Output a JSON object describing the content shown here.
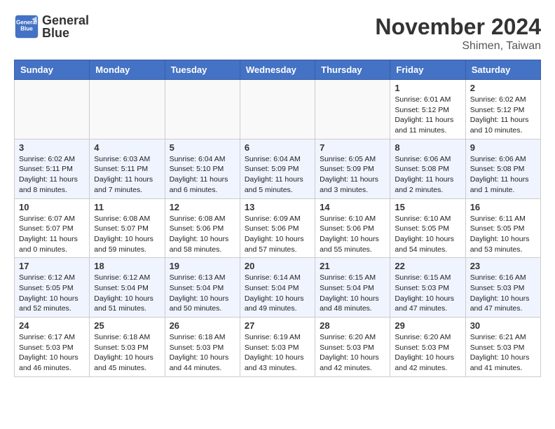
{
  "logo": {
    "line1": "General",
    "line2": "Blue"
  },
  "title": "November 2024",
  "subtitle": "Shimen, Taiwan",
  "days_of_week": [
    "Sunday",
    "Monday",
    "Tuesday",
    "Wednesday",
    "Thursday",
    "Friday",
    "Saturday"
  ],
  "weeks": [
    [
      {
        "day": "",
        "info": ""
      },
      {
        "day": "",
        "info": ""
      },
      {
        "day": "",
        "info": ""
      },
      {
        "day": "",
        "info": ""
      },
      {
        "day": "",
        "info": ""
      },
      {
        "day": "1",
        "info": "Sunrise: 6:01 AM\nSunset: 5:12 PM\nDaylight: 11 hours\nand 11 minutes."
      },
      {
        "day": "2",
        "info": "Sunrise: 6:02 AM\nSunset: 5:12 PM\nDaylight: 11 hours\nand 10 minutes."
      }
    ],
    [
      {
        "day": "3",
        "info": "Sunrise: 6:02 AM\nSunset: 5:11 PM\nDaylight: 11 hours\nand 8 minutes."
      },
      {
        "day": "4",
        "info": "Sunrise: 6:03 AM\nSunset: 5:11 PM\nDaylight: 11 hours\nand 7 minutes."
      },
      {
        "day": "5",
        "info": "Sunrise: 6:04 AM\nSunset: 5:10 PM\nDaylight: 11 hours\nand 6 minutes."
      },
      {
        "day": "6",
        "info": "Sunrise: 6:04 AM\nSunset: 5:09 PM\nDaylight: 11 hours\nand 5 minutes."
      },
      {
        "day": "7",
        "info": "Sunrise: 6:05 AM\nSunset: 5:09 PM\nDaylight: 11 hours\nand 3 minutes."
      },
      {
        "day": "8",
        "info": "Sunrise: 6:06 AM\nSunset: 5:08 PM\nDaylight: 11 hours\nand 2 minutes."
      },
      {
        "day": "9",
        "info": "Sunrise: 6:06 AM\nSunset: 5:08 PM\nDaylight: 11 hours\nand 1 minute."
      }
    ],
    [
      {
        "day": "10",
        "info": "Sunrise: 6:07 AM\nSunset: 5:07 PM\nDaylight: 11 hours\nand 0 minutes."
      },
      {
        "day": "11",
        "info": "Sunrise: 6:08 AM\nSunset: 5:07 PM\nDaylight: 10 hours\nand 59 minutes."
      },
      {
        "day": "12",
        "info": "Sunrise: 6:08 AM\nSunset: 5:06 PM\nDaylight: 10 hours\nand 58 minutes."
      },
      {
        "day": "13",
        "info": "Sunrise: 6:09 AM\nSunset: 5:06 PM\nDaylight: 10 hours\nand 57 minutes."
      },
      {
        "day": "14",
        "info": "Sunrise: 6:10 AM\nSunset: 5:06 PM\nDaylight: 10 hours\nand 55 minutes."
      },
      {
        "day": "15",
        "info": "Sunrise: 6:10 AM\nSunset: 5:05 PM\nDaylight: 10 hours\nand 54 minutes."
      },
      {
        "day": "16",
        "info": "Sunrise: 6:11 AM\nSunset: 5:05 PM\nDaylight: 10 hours\nand 53 minutes."
      }
    ],
    [
      {
        "day": "17",
        "info": "Sunrise: 6:12 AM\nSunset: 5:05 PM\nDaylight: 10 hours\nand 52 minutes."
      },
      {
        "day": "18",
        "info": "Sunrise: 6:12 AM\nSunset: 5:04 PM\nDaylight: 10 hours\nand 51 minutes."
      },
      {
        "day": "19",
        "info": "Sunrise: 6:13 AM\nSunset: 5:04 PM\nDaylight: 10 hours\nand 50 minutes."
      },
      {
        "day": "20",
        "info": "Sunrise: 6:14 AM\nSunset: 5:04 PM\nDaylight: 10 hours\nand 49 minutes."
      },
      {
        "day": "21",
        "info": "Sunrise: 6:15 AM\nSunset: 5:04 PM\nDaylight: 10 hours\nand 48 minutes."
      },
      {
        "day": "22",
        "info": "Sunrise: 6:15 AM\nSunset: 5:03 PM\nDaylight: 10 hours\nand 47 minutes."
      },
      {
        "day": "23",
        "info": "Sunrise: 6:16 AM\nSunset: 5:03 PM\nDaylight: 10 hours\nand 47 minutes."
      }
    ],
    [
      {
        "day": "24",
        "info": "Sunrise: 6:17 AM\nSunset: 5:03 PM\nDaylight: 10 hours\nand 46 minutes."
      },
      {
        "day": "25",
        "info": "Sunrise: 6:18 AM\nSunset: 5:03 PM\nDaylight: 10 hours\nand 45 minutes."
      },
      {
        "day": "26",
        "info": "Sunrise: 6:18 AM\nSunset: 5:03 PM\nDaylight: 10 hours\nand 44 minutes."
      },
      {
        "day": "27",
        "info": "Sunrise: 6:19 AM\nSunset: 5:03 PM\nDaylight: 10 hours\nand 43 minutes."
      },
      {
        "day": "28",
        "info": "Sunrise: 6:20 AM\nSunset: 5:03 PM\nDaylight: 10 hours\nand 42 minutes."
      },
      {
        "day": "29",
        "info": "Sunrise: 6:20 AM\nSunset: 5:03 PM\nDaylight: 10 hours\nand 42 minutes."
      },
      {
        "day": "30",
        "info": "Sunrise: 6:21 AM\nSunset: 5:03 PM\nDaylight: 10 hours\nand 41 minutes."
      }
    ]
  ]
}
